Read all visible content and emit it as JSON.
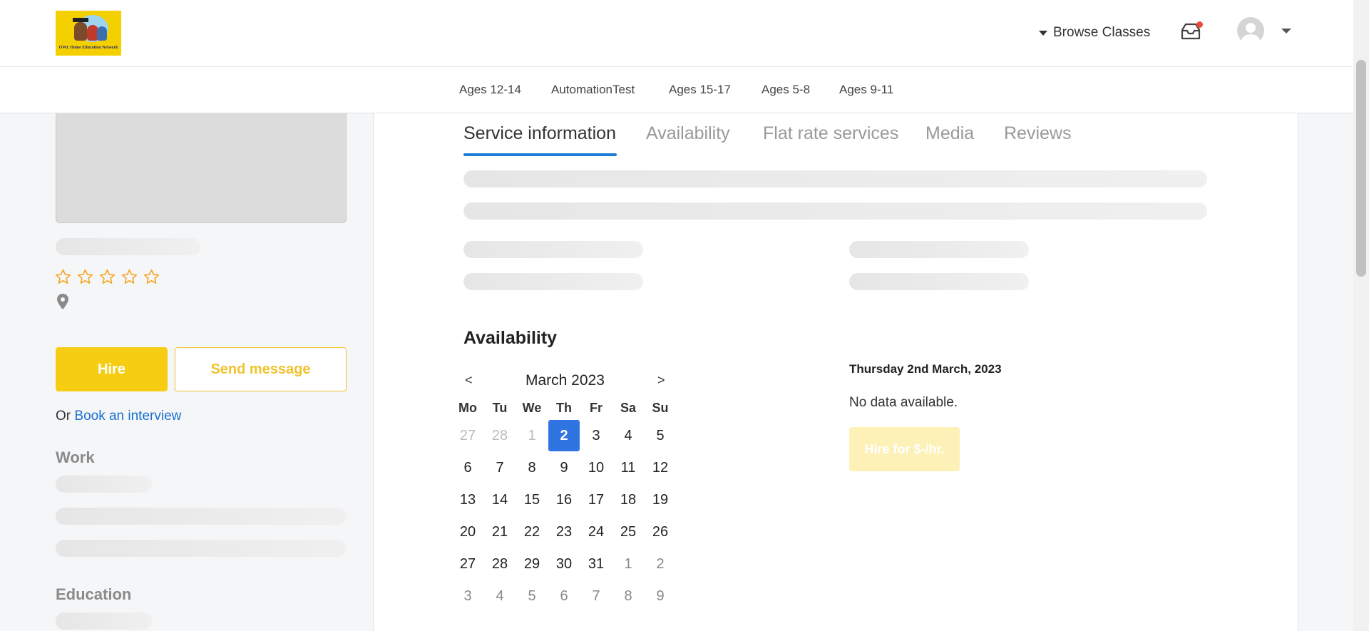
{
  "header": {
    "logo_text": "OWL Home Education Network",
    "browse_label": "Browse Classes",
    "inbox_icon": "inbox-icon",
    "notification_color": "#e74c3c"
  },
  "categories": [
    "Ages 12-14",
    "AutomationTest",
    "Ages 15-17",
    "Ages 5-8",
    "Ages 9-11"
  ],
  "profile": {
    "rating_icon": "star-outline-icon",
    "star_color": "#f5a623",
    "hire_label": "Hire",
    "send_message_label": "Send message",
    "or_text": "Or ",
    "book_interview_label": "Book an interview",
    "work_title": "Work",
    "education_title": "Education"
  },
  "tabs": [
    "Service information",
    "Availability",
    "Flat rate services",
    "Media",
    "Reviews"
  ],
  "active_tab": "Service information",
  "availability": {
    "title": "Availability",
    "prev_label": "<",
    "next_label": ">",
    "month_label": "March 2023",
    "weekdays": [
      "Mo",
      "Tu",
      "We",
      "Th",
      "Fr",
      "Sa",
      "Su"
    ],
    "weeks": [
      [
        "27",
        "28",
        "1",
        "2",
        "3",
        "4",
        "5"
      ],
      [
        "6",
        "7",
        "8",
        "9",
        "10",
        "11",
        "12"
      ],
      [
        "13",
        "14",
        "15",
        "16",
        "17",
        "18",
        "19"
      ],
      [
        "20",
        "21",
        "22",
        "23",
        "24",
        "25",
        "26"
      ],
      [
        "27",
        "28",
        "29",
        "30",
        "31",
        "1",
        "2"
      ],
      [
        "3",
        "4",
        "5",
        "6",
        "7",
        "8",
        "9"
      ]
    ],
    "selected_date": "Thursday 2nd March, 2023",
    "no_data_text": "No data available.",
    "hire_rate_label": "Hire for $-/hr.",
    "selected_color": "#2f74e0"
  }
}
